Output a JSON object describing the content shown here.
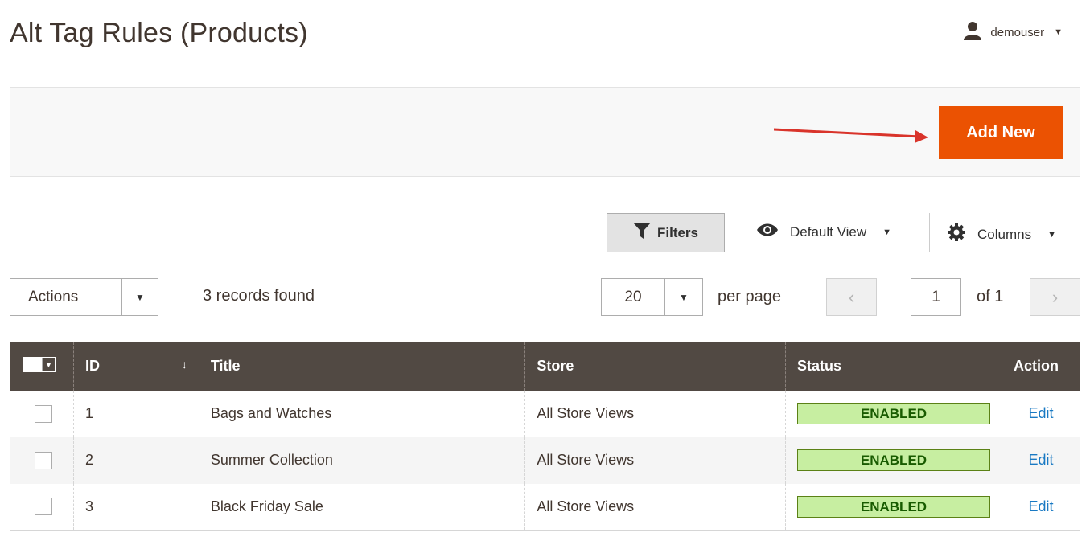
{
  "page": {
    "title": "Alt Tag Rules (Products)"
  },
  "user": {
    "name": "demouser"
  },
  "actions_bar": {
    "add_new_label": "Add New"
  },
  "toolbar": {
    "filters_label": "Filters",
    "view_label": "Default View",
    "columns_label": "Columns"
  },
  "pager": {
    "mass_action_label": "Actions",
    "records_text": "3 records found",
    "per_page_value": "20",
    "per_page_label": "per page",
    "current_page": "1",
    "of_text": "of 1"
  },
  "grid": {
    "headers": {
      "id": "ID",
      "title": "Title",
      "store": "Store",
      "status": "Status",
      "action": "Action"
    },
    "rows": [
      {
        "id": "1",
        "title": "Bags and Watches",
        "store": "All Store Views",
        "status": "ENABLED",
        "action": "Edit"
      },
      {
        "id": "2",
        "title": "Summer Collection",
        "store": "All Store Views",
        "status": "ENABLED",
        "action": "Edit"
      },
      {
        "id": "3",
        "title": "Black Friday Sale",
        "store": "All Store Views",
        "status": "ENABLED",
        "action": "Edit"
      }
    ]
  },
  "colors": {
    "accent": "#eb5202",
    "header_bg": "#514943",
    "status_bg": "#c7eea1",
    "link": "#1979c3",
    "annotation_arrow": "#d9342b"
  },
  "icons": {
    "user": "user-icon",
    "filter": "filter-icon",
    "view": "eye-icon",
    "columns": "gear-icon"
  }
}
